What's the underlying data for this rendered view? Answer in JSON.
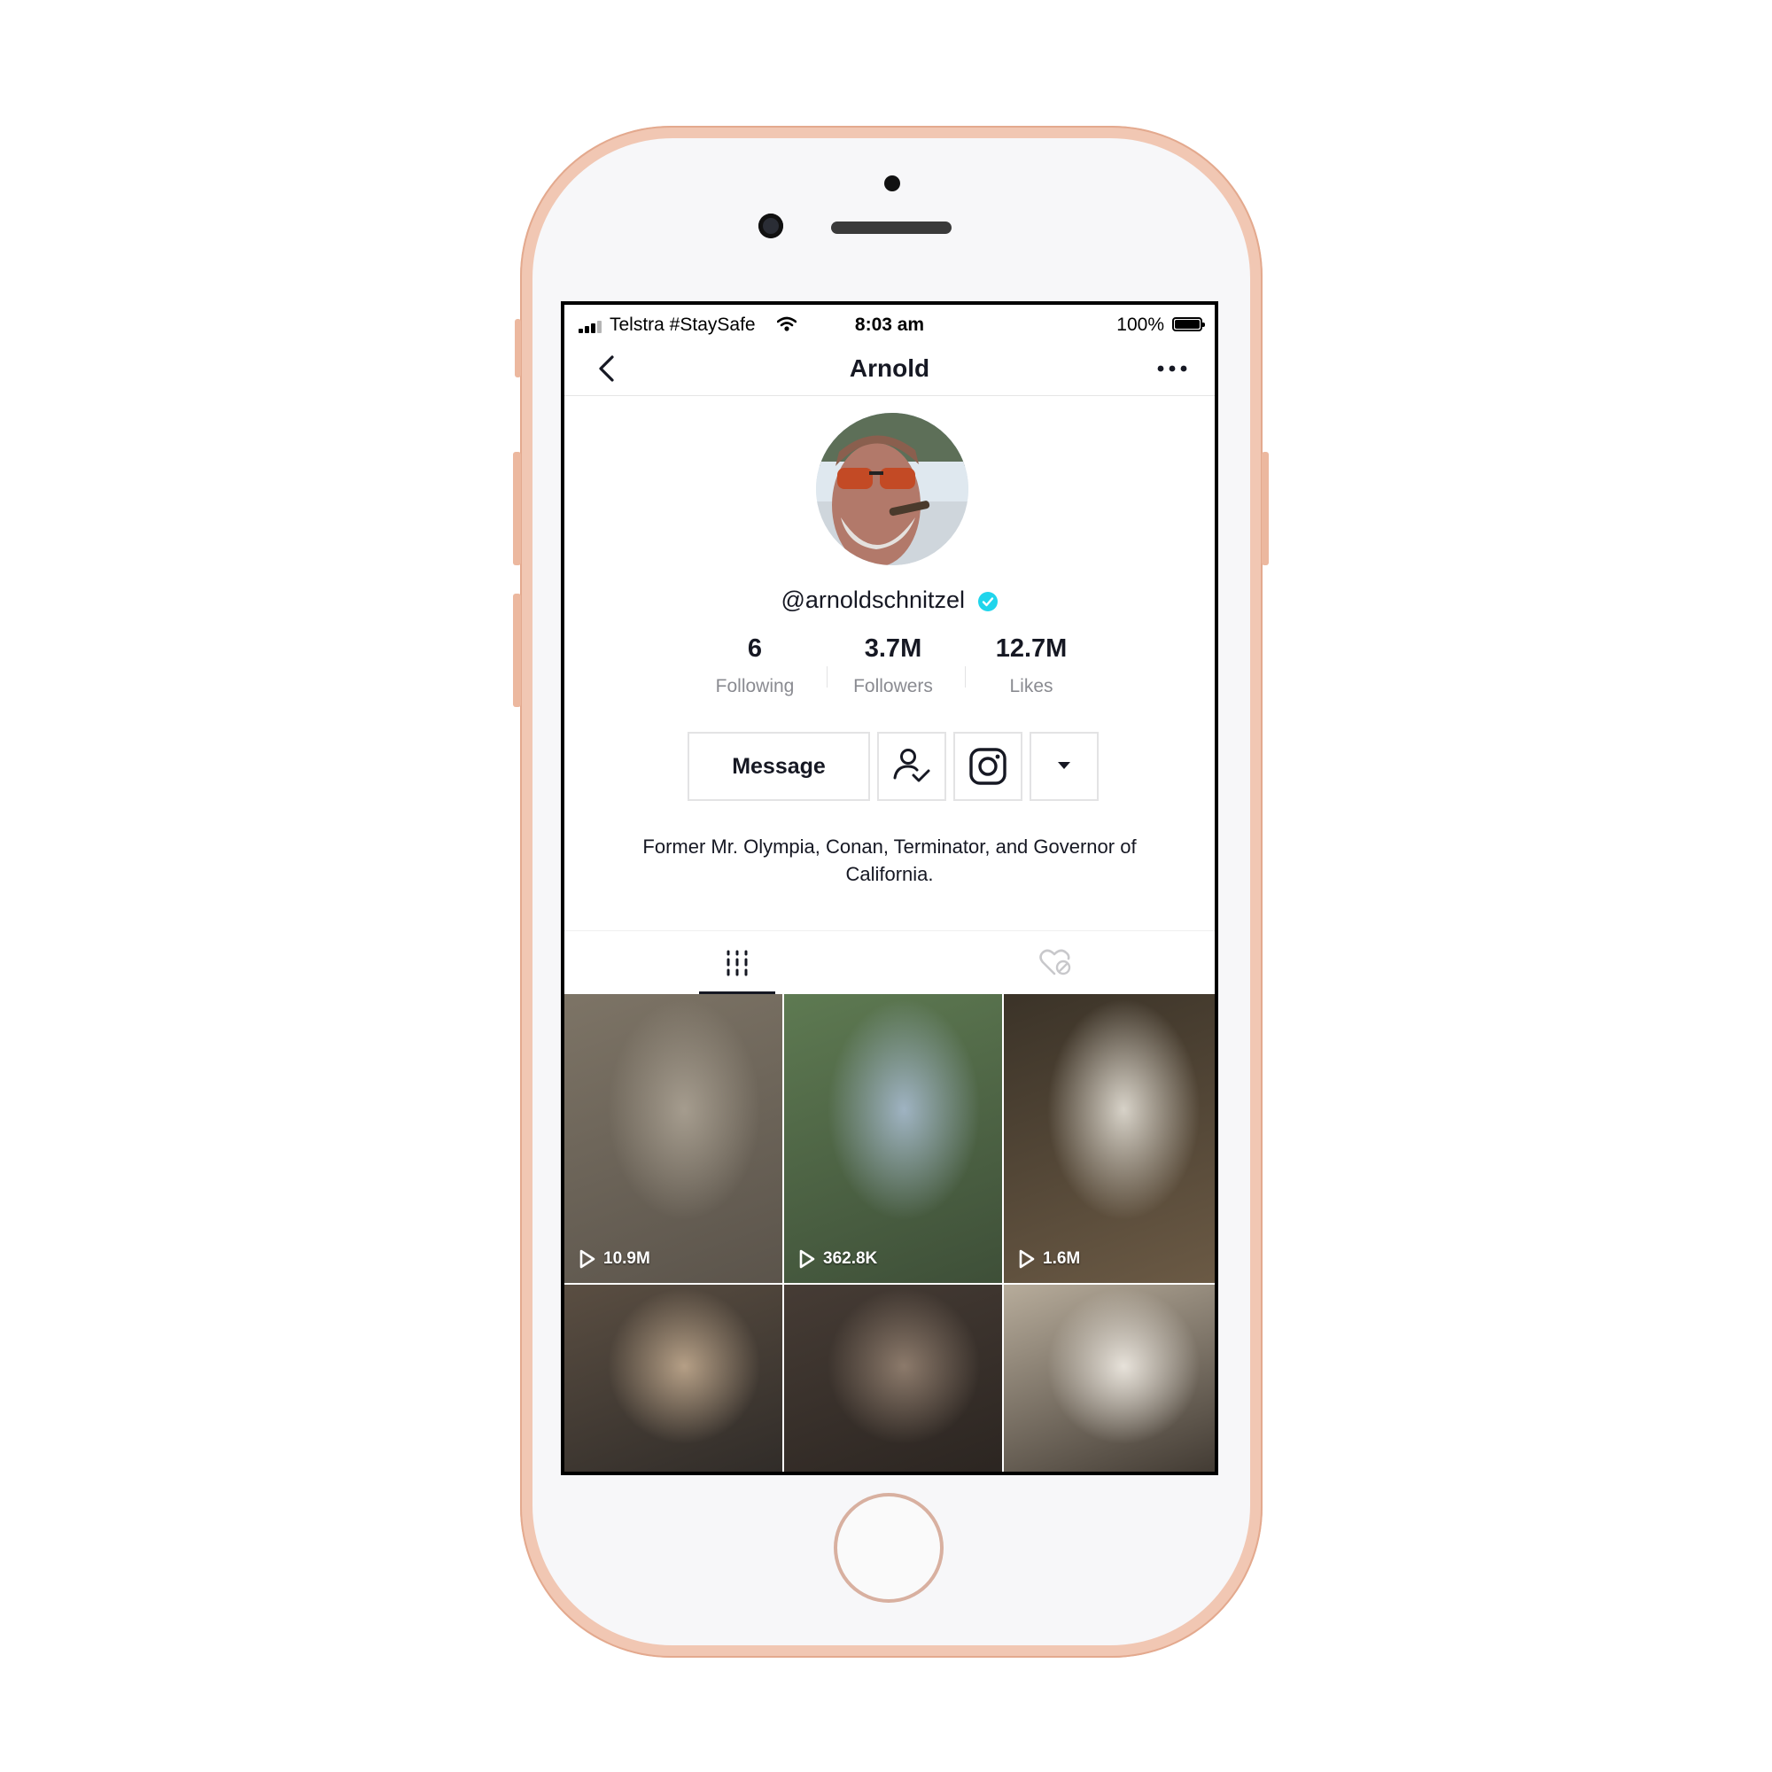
{
  "status_bar": {
    "carrier": "Telstra #StaySafe",
    "time": "8:03 am",
    "battery": "100%",
    "battery_level": 1.0
  },
  "nav": {
    "title": "Arnold",
    "back_icon": "chevron-left-icon",
    "more_icon": "more-horizontal-icon"
  },
  "profile": {
    "username": "@arnoldschnitzel",
    "verified": true,
    "stats": [
      {
        "value": "6",
        "label": "Following"
      },
      {
        "value": "3.7M",
        "label": "Followers"
      },
      {
        "value": "12.7M",
        "label": "Likes"
      }
    ],
    "message_label": "Message",
    "bio": "Former Mr. Olympia, Conan, Terminator, and Governor of California."
  },
  "tabs": [
    {
      "icon": "grid-icon",
      "active": true
    },
    {
      "icon": "liked-private-icon",
      "active": false
    }
  ],
  "videos": [
    {
      "views": "10.9M",
      "colors": [
        "#7d7466",
        "#a59c8e",
        "#5b544b"
      ]
    },
    {
      "views": "362.8K",
      "colors": [
        "#5e7a52",
        "#9fb3c2",
        "#3e4f38"
      ]
    },
    {
      "views": "1.6M",
      "colors": [
        "#3b3328",
        "#d7d2c8",
        "#6b5a45"
      ]
    },
    {
      "views": "",
      "colors": [
        "#5a4e42",
        "#b59f86",
        "#2e2a27"
      ]
    },
    {
      "views": "",
      "colors": [
        "#463c35",
        "#8c7a6b",
        "#2a2420"
      ]
    },
    {
      "views": "",
      "colors": [
        "#b7ac9b",
        "#e7e2da",
        "#3a332c"
      ]
    }
  ],
  "colors": {
    "text_primary": "#161823",
    "text_secondary": "#8a8b91",
    "verified_blue": "#20d5ec",
    "phone_gold": "#f1c7b3"
  }
}
